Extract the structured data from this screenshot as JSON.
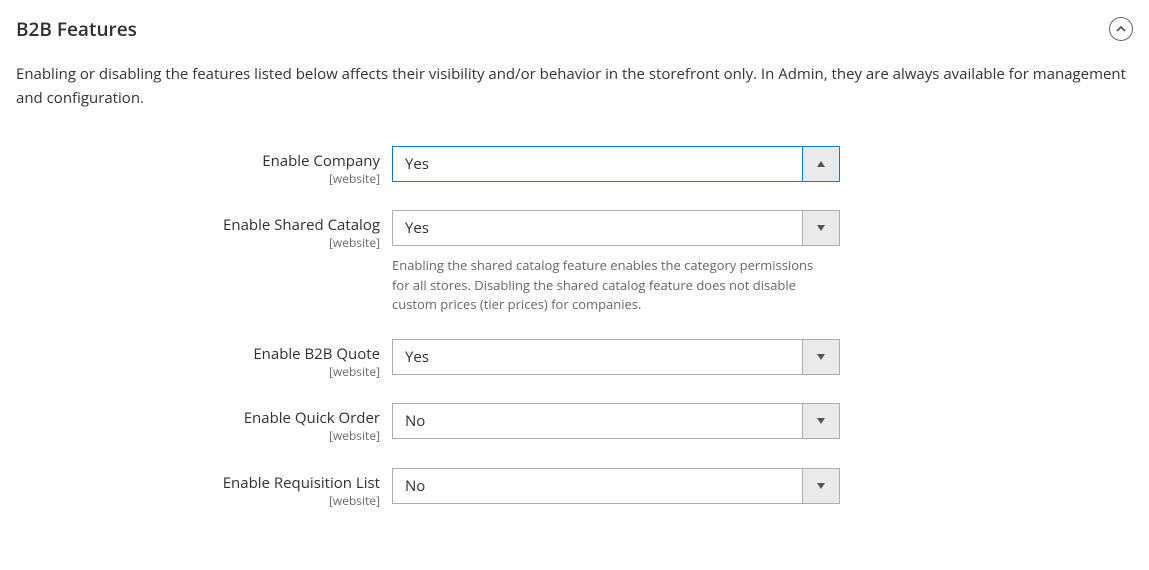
{
  "section": {
    "title": "B2B Features",
    "description": "Enabling or disabling the features listed below affects their visibility and/or behavior in the storefront only. In Admin, they are always available for management and configuration."
  },
  "scopeLabel": "[website]",
  "fields": {
    "enableCompany": {
      "label": "Enable Company",
      "value": "Yes"
    },
    "enableSharedCatalog": {
      "label": "Enable Shared Catalog",
      "value": "Yes",
      "help": "Enabling the shared catalog feature enables the category permissions for all stores. Disabling the shared catalog feature does not disable custom prices (tier prices) for companies."
    },
    "enableB2BQuote": {
      "label": "Enable B2B Quote",
      "value": "Yes"
    },
    "enableQuickOrder": {
      "label": "Enable Quick Order",
      "value": "No"
    },
    "enableRequisitionList": {
      "label": "Enable Requisition List",
      "value": "No"
    }
  }
}
